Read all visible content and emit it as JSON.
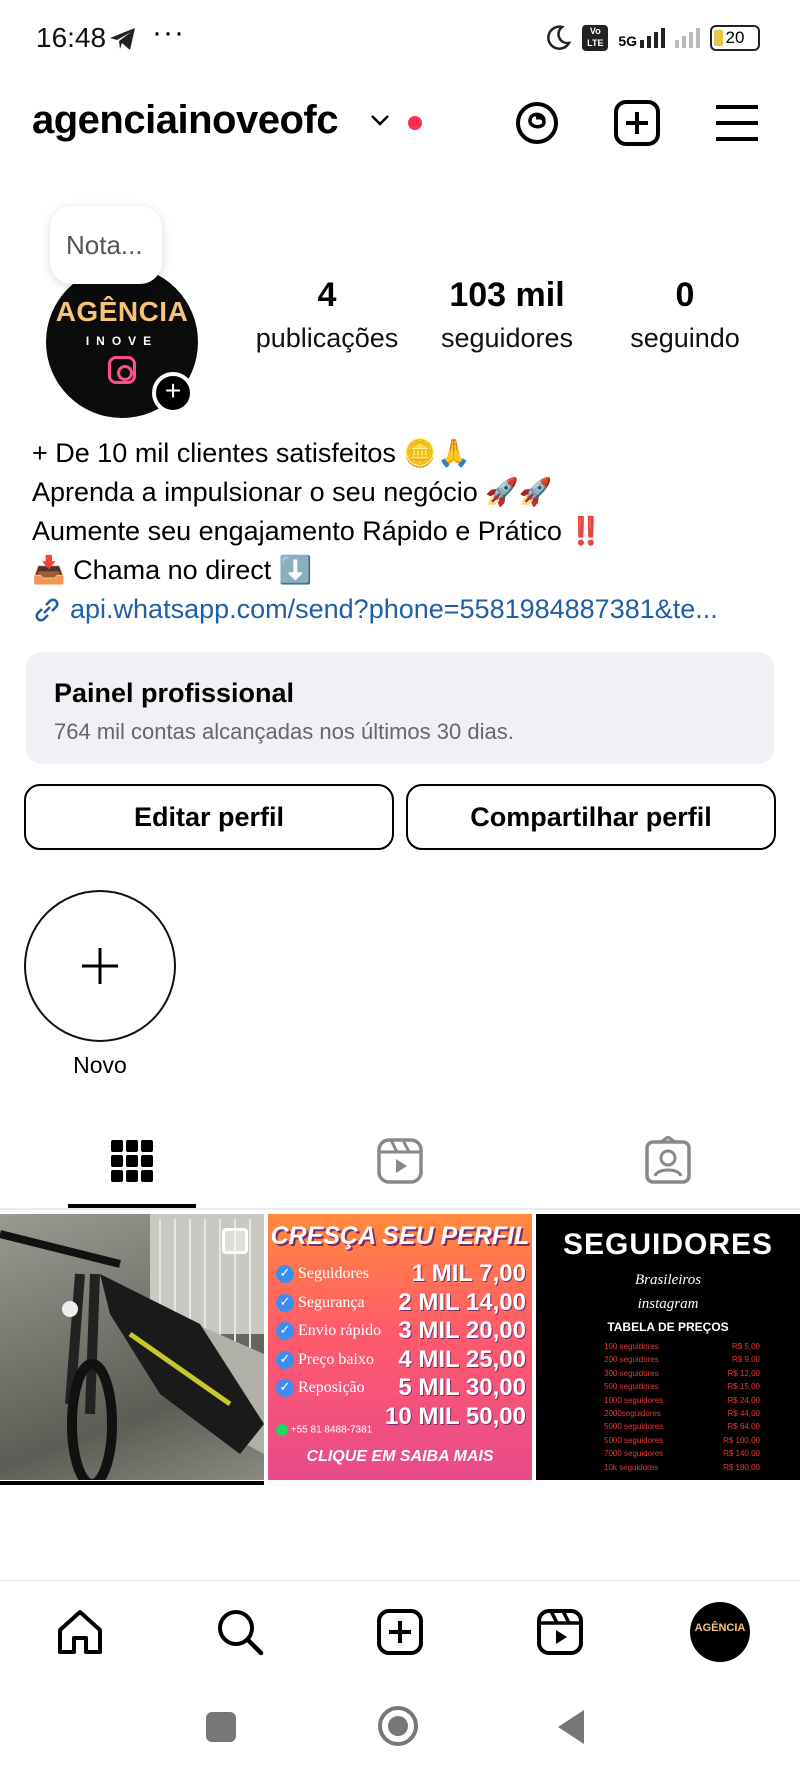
{
  "status_bar": {
    "time": "16:48",
    "more": "···",
    "volte": "Vo LTE",
    "network": "5G",
    "battery": "20"
  },
  "header": {
    "username": "agenciainoveofc"
  },
  "profile": {
    "note": "Nota...",
    "avatar_title": "AGÊNCIA",
    "avatar_subtitle": "INOVE",
    "stats": [
      {
        "value": "4",
        "label": "publicações"
      },
      {
        "value": "103 mil",
        "label": "seguidores"
      },
      {
        "value": "0",
        "label": "seguindo"
      }
    ],
    "bio": [
      "+ De 10 mil clientes satisfeitos 🪙🙏",
      "Aprenda a impulsionar o seu negócio 🚀🚀",
      "Aumente seu engajamento Rápido e Prático ‼️",
      "📥 Chama no direct ⬇️"
    ],
    "link": "api.whatsapp.com/send?phone=5581984887381&te..."
  },
  "professional_panel": {
    "title": "Painel profissional",
    "subtitle": "764 mil contas alcançadas nos últimos 30 dias."
  },
  "buttons": {
    "edit": "Editar perfil",
    "share": "Compartilhar perfil"
  },
  "highlight": {
    "label": "Novo"
  },
  "tabs": [
    "grid",
    "reels",
    "tagged"
  ],
  "promo_post": {
    "title": "CRESÇA SEU PERFIL",
    "rows": [
      {
        "label": "Seguidores",
        "price": "1 MIL 7,00"
      },
      {
        "label": "Segurança",
        "price": "2 MIL 14,00"
      },
      {
        "label": "Envio rápido",
        "price": "3 MIL 20,00"
      },
      {
        "label": "Preço baixo",
        "price": "4 MIL 25,00"
      },
      {
        "label": "Reposição",
        "price": "5 MIL 30,00"
      },
      {
        "label": "",
        "price": "10 MIL 50,00"
      }
    ],
    "phone": "+55 81 8488-7381",
    "cta": "CLIQUE EM SAIBA MAIS"
  },
  "seguidores_post": {
    "title": "SEGUIDORES",
    "subtitle1": "Brasileiros",
    "subtitle2": "instagram",
    "table_title": "TABELA DE PREÇOS",
    "rows": [
      {
        "qty": "100 seguidores",
        "price": "R$ 5,00"
      },
      {
        "qty": "200 seguidores",
        "price": "R$ 9,00"
      },
      {
        "qty": "300 seguidores",
        "price": "R$ 12,00"
      },
      {
        "qty": "500 seguidores",
        "price": "R$ 15,00"
      },
      {
        "qty": "1000 seguidores",
        "price": "R$ 24,00"
      },
      {
        "qty": "2000seguidores",
        "price": "R$ 44,00"
      },
      {
        "qty": "5000 seguidores",
        "price": "R$ 64,00"
      },
      {
        "qty": "5000 seguidores",
        "price": "R$ 100,00"
      },
      {
        "qty": "7000 seguidores",
        "price": "R$ 140,00"
      },
      {
        "qty": "10k seguidores",
        "price": "R$ 180,00"
      }
    ]
  },
  "nav_avatar": "AGÊNCIA"
}
